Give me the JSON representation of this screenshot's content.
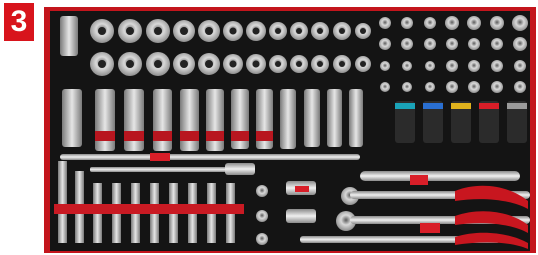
{
  "badge": {
    "number": "3",
    "color": "#d8141c"
  },
  "photo": {
    "subject": "tool tray",
    "colors": {
      "foam": "#141414",
      "frame": "#c3151c",
      "chrome": "#c9c9c9",
      "accent_red": "#d81e28"
    },
    "icons": [
      "tool-tray-photo-icon"
    ]
  }
}
